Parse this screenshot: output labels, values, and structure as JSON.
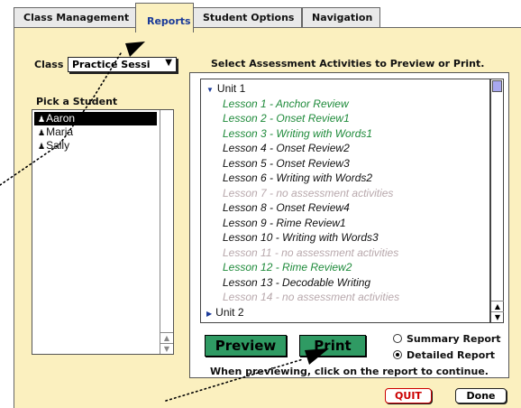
{
  "tabs": [
    {
      "label": "Class Management"
    },
    {
      "label": "Reports"
    },
    {
      "label": "Student Options"
    },
    {
      "label": "Navigation"
    }
  ],
  "class_selector": {
    "label": "Class",
    "value": "Practice Sessi"
  },
  "students": {
    "heading": "Pick a Student",
    "items": [
      {
        "name": "Aaron",
        "selected": true
      },
      {
        "name": "Maria",
        "selected": false
      },
      {
        "name": "Sally",
        "selected": false
      }
    ]
  },
  "activities": {
    "heading": "Select Assessment Activities to Preview or Print.",
    "items": [
      {
        "label": "Unit 1",
        "kind": "unit"
      },
      {
        "label": "Lesson 1 - Anchor Review",
        "kind": "green"
      },
      {
        "label": "Lesson 2 - Onset Review1",
        "kind": "green"
      },
      {
        "label": "Lesson 3 - Writing with Words1",
        "kind": "green"
      },
      {
        "label": "Lesson 4 - Onset Review2",
        "kind": "black"
      },
      {
        "label": "Lesson 5 - Onset Review3",
        "kind": "black"
      },
      {
        "label": "Lesson 6 - Writing with Words2",
        "kind": "black"
      },
      {
        "label": "Lesson 7 - no assessment activities",
        "kind": "gray"
      },
      {
        "label": "Lesson 8 - Onset Review4",
        "kind": "black"
      },
      {
        "label": "Lesson 9 - Rime Review1",
        "kind": "black"
      },
      {
        "label": "Lesson 10 - Writing with Words3",
        "kind": "black"
      },
      {
        "label": "Lesson 11 - no assessment activities",
        "kind": "gray"
      },
      {
        "label": "Lesson 12 - Rime Review2",
        "kind": "green"
      },
      {
        "label": "Lesson 13 - Decodable Writing",
        "kind": "black"
      },
      {
        "label": "Lesson 14 - no assessment activities",
        "kind": "gray"
      },
      {
        "label": "Unit 2",
        "kind": "unit"
      }
    ]
  },
  "actions": {
    "preview_label": "Preview",
    "print_label": "Print"
  },
  "report_type": {
    "summary_label": "Summary Report",
    "detailed_label": "Detailed Report",
    "selected": "detailed"
  },
  "note": "When previewing, click on the report to continue.",
  "footer": {
    "quit_label": "QUIT",
    "done_label": "Done"
  },
  "colors": {
    "panel_bg": "#fbf0bf",
    "active_tab_text": "#1a3a99",
    "button_green": "#2f9a63",
    "lesson_green": "#1e8a3a",
    "lesson_gray": "#b8a8ac",
    "quit_red": "#cc0000"
  }
}
